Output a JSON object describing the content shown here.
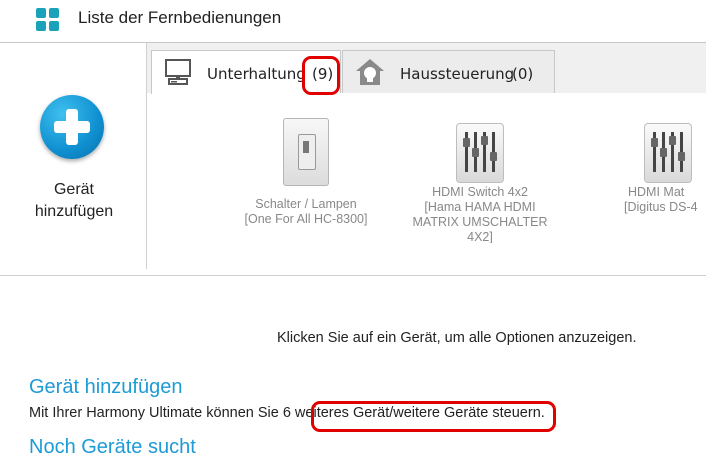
{
  "header": {
    "title": "Liste der Fernbedienungen",
    "icon": "grid-icon"
  },
  "left_panel": {
    "add_line1": "Gerät",
    "add_line2": "hinzufügen",
    "icon": "plus-circle-icon"
  },
  "tabs": [
    {
      "label": "Unterhaltung",
      "count": "(9)",
      "icon": "monitor-icon",
      "active": true
    },
    {
      "label": "Haussteuerung",
      "count": "(0)",
      "icon": "lightbulb-icon",
      "active": false
    }
  ],
  "devices": [
    {
      "name": "Schalter / Lampen",
      "model": "[One For All HC-8300]",
      "icon": "switch-icon"
    },
    {
      "name": "HDMI Switch 4x2",
      "model": "[Hama HAMA HDMI MATRIX UMSCHALTER 4X2]",
      "icon": "equalizer-icon"
    },
    {
      "name": "HDMI Mat",
      "model": "[Digitus DS-4",
      "icon": "equalizer-icon"
    }
  ],
  "hint": "Klicken Sie auf ein Gerät, um alle Optionen anzuzeigen.",
  "add_section": {
    "title": "Gerät hinzufügen",
    "text_before": "Mit Ihrer Harmony Ultimate können Sie ",
    "text_highlight": "6 weiteres Gerät/weitere Geräte",
    "text_after": " steuern."
  },
  "next_section": {
    "title": "Noch Geräte sucht"
  },
  "colors": {
    "accent": "#1d9bd7",
    "highlight": "#e00000",
    "icon_teal": "#1aa3b8"
  }
}
